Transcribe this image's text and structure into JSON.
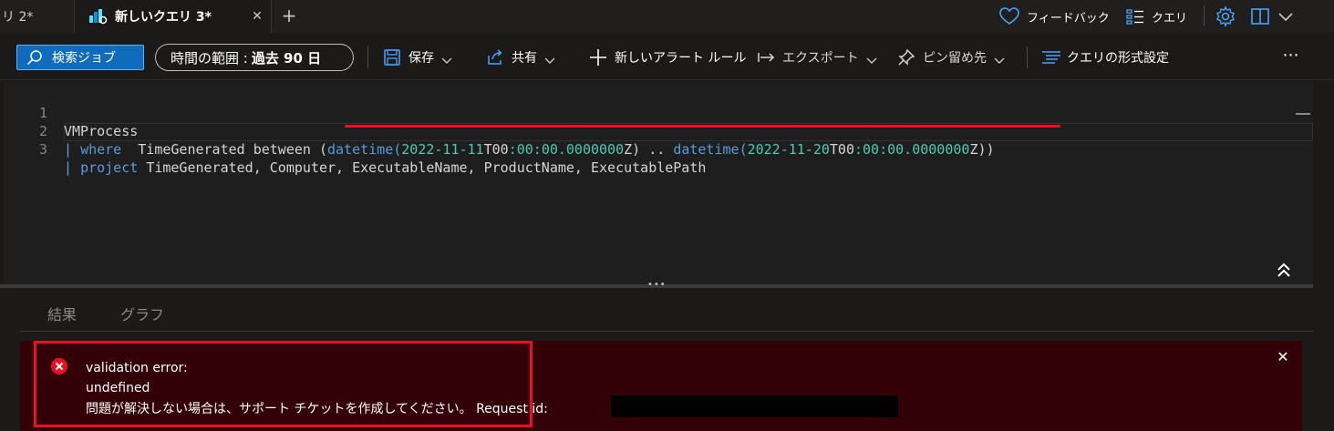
{
  "tabs": {
    "previous_tab_label": "リ 2*",
    "active_tab_label": "新しいクエリ 3*"
  },
  "topbar": {
    "feedback_label": "フィードバック",
    "query_label": "クエリ"
  },
  "toolbar": {
    "search_jobs_label": "検索ジョブ",
    "time_range_label": "時間の範囲 :",
    "time_range_value": "過去 90 日",
    "save_label": "保存",
    "share_label": "共有",
    "new_alert_rule_label": "新しいアラート ルール",
    "export_label": "エクスポート",
    "pin_label": "ピン留め先",
    "format_query_label": "クエリの形式設定",
    "more_label": "⋯"
  },
  "editor": {
    "line_numbers": [
      "1",
      "2",
      "3"
    ],
    "line1": "VMProcess",
    "line2": {
      "pipe": "|",
      "keyword": "where",
      "column": "TimeGenerated between (",
      "fn1": "datetime",
      "open1": "(",
      "date1": "2022-11-11",
      "t1": "T00",
      "colon1a": ":",
      "mm1": "00",
      "colon1b": ":",
      "ss1": "00.0000000",
      "z1": "Z)",
      "range_op": " .. ",
      "fn2": "datetime",
      "open2": "(",
      "date2": "2022-11-20",
      "t2": "T00",
      "colon2a": ":",
      "mm2": "00",
      "colon2b": ":",
      "ss2": "00.0000000",
      "z2": "Z))"
    },
    "line3": {
      "pipe": "|",
      "keyword": "project",
      "columns": "TimeGenerated, Computer, ExecutableName, ProductName, ExecutablePath"
    }
  },
  "results": {
    "tab_results": "結果",
    "tab_chart": "グラフ"
  },
  "error": {
    "title": "validation error:",
    "detail": "undefined",
    "message": "問題が解決しない場合は、サポート チケットを作成してください。",
    "request_id_label": "Request id:",
    "close_label": "✕"
  },
  "colors": {
    "accent_blue": "#0f6cbd",
    "error_bg": "#340007",
    "error_red": "#e81123",
    "keyword": "#569cd6",
    "number": "#4ec9b0"
  }
}
